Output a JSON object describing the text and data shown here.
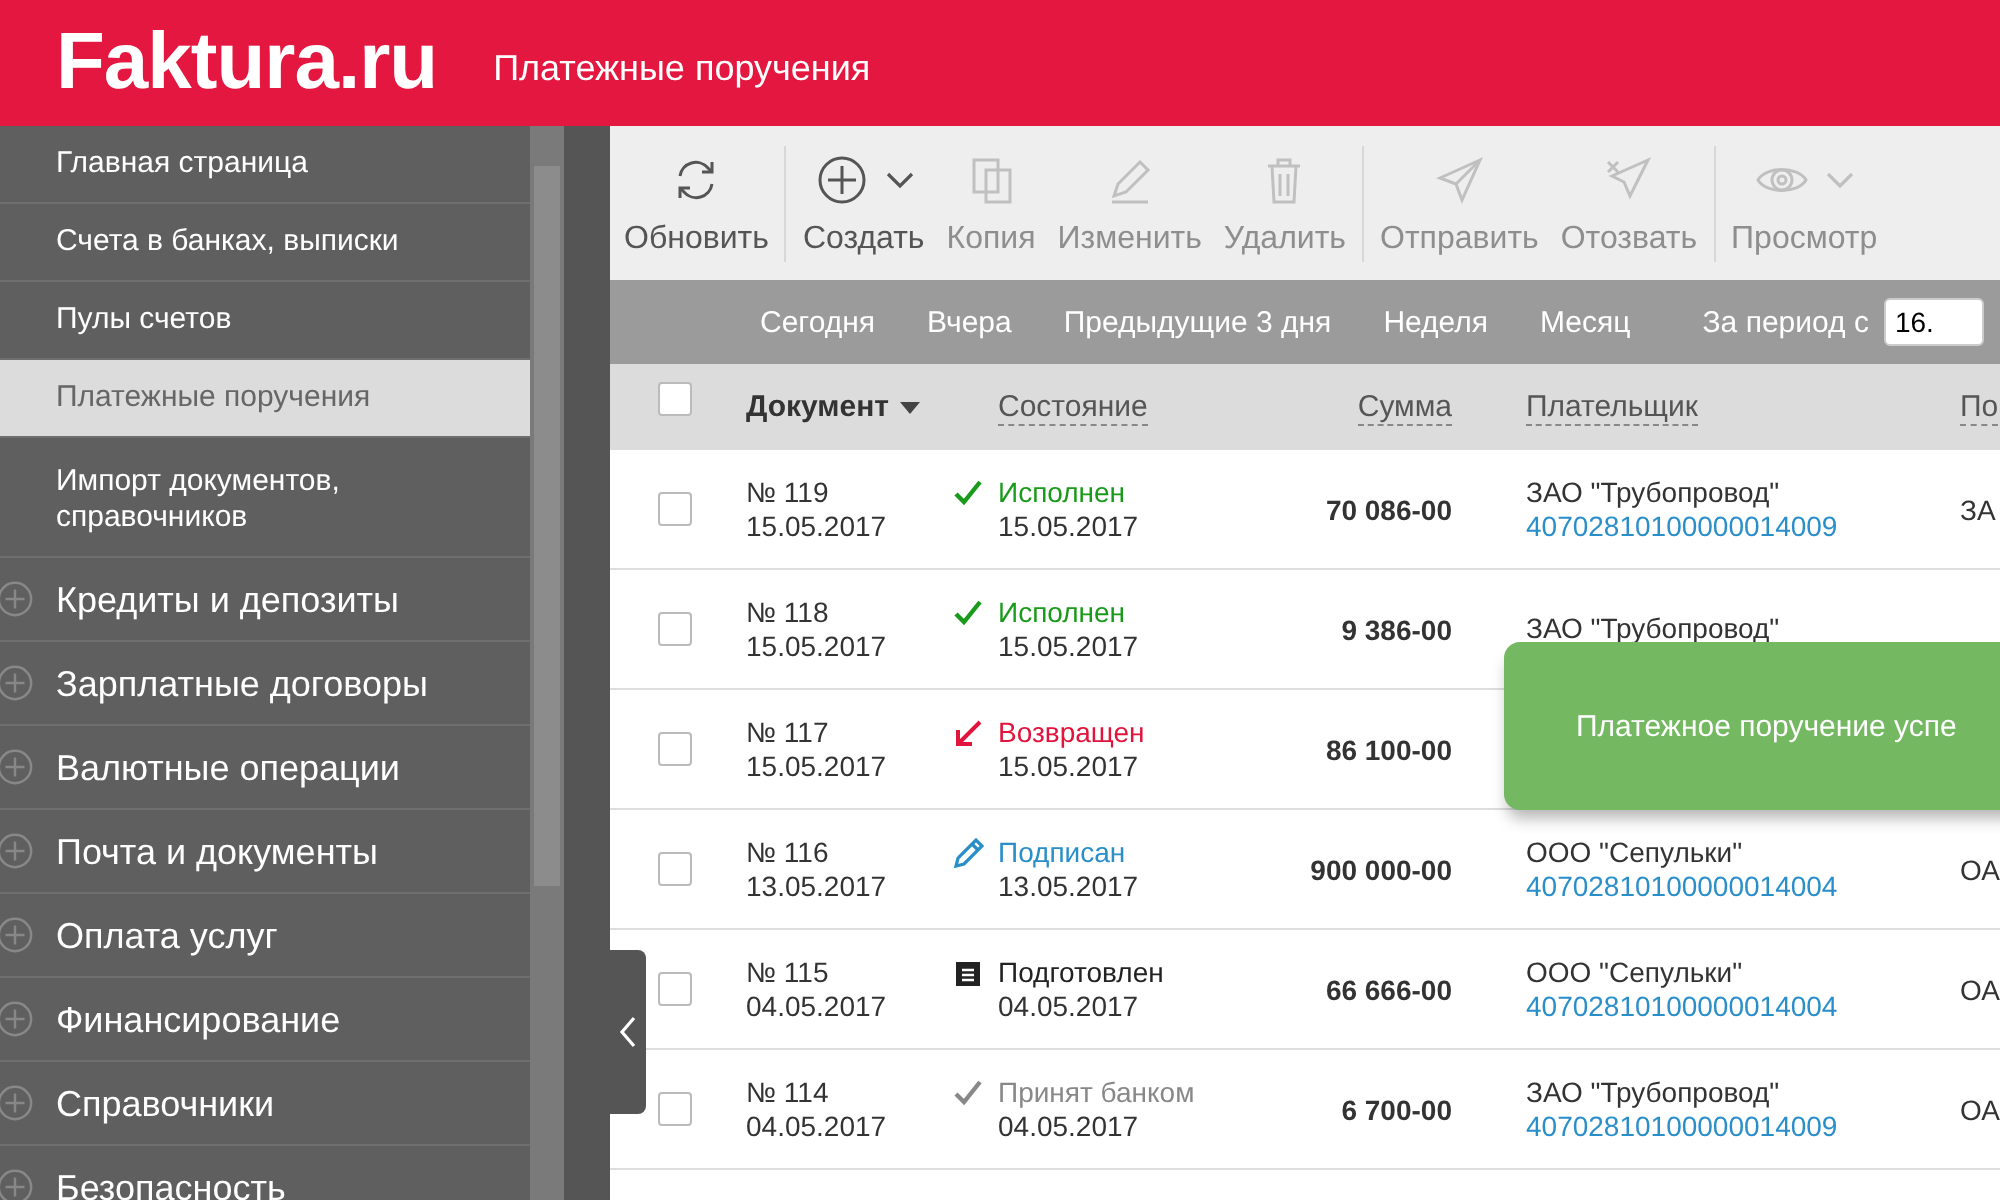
{
  "header": {
    "logo": "Faktura.ru",
    "title": "Платежные поручения"
  },
  "sidebar": {
    "items": [
      {
        "label": "Главная страница",
        "kind": "link",
        "selected": false
      },
      {
        "label": "Счета в банках, выписки",
        "kind": "link",
        "selected": false
      },
      {
        "label": "Пулы счетов",
        "kind": "link",
        "selected": false
      },
      {
        "label": "Платежные поручения",
        "kind": "link",
        "selected": true
      },
      {
        "label": "Импорт документов, справочников",
        "kind": "link",
        "selected": false
      },
      {
        "label": "Кредиты и депозиты",
        "kind": "group",
        "selected": false
      },
      {
        "label": "Зарплатные договоры",
        "kind": "group",
        "selected": false
      },
      {
        "label": "Валютные операции",
        "kind": "group",
        "selected": false
      },
      {
        "label": "Почта и документы",
        "kind": "group",
        "selected": false
      },
      {
        "label": "Оплата услуг",
        "kind": "group",
        "selected": false
      },
      {
        "label": "Финансирование",
        "kind": "group",
        "selected": false
      },
      {
        "label": "Справочники",
        "kind": "group",
        "selected": false
      },
      {
        "label": "Безопасность",
        "kind": "group",
        "selected": false
      }
    ]
  },
  "toolbar": [
    {
      "label": "Обновить",
      "kind": "refresh",
      "disabled": false,
      "dropdown": false,
      "separator_after": true
    },
    {
      "label": "Создать",
      "kind": "create",
      "disabled": false,
      "dropdown": true,
      "separator_after": false
    },
    {
      "label": "Копия",
      "kind": "copy",
      "disabled": true,
      "dropdown": false,
      "separator_after": false
    },
    {
      "label": "Изменить",
      "kind": "edit",
      "disabled": true,
      "dropdown": false,
      "separator_after": false
    },
    {
      "label": "Удалить",
      "kind": "delete",
      "disabled": true,
      "dropdown": false,
      "separator_after": true
    },
    {
      "label": "Отправить",
      "kind": "send",
      "disabled": true,
      "dropdown": false,
      "separator_after": false
    },
    {
      "label": "Отозвать",
      "kind": "recall",
      "disabled": true,
      "dropdown": false,
      "separator_after": true
    },
    {
      "label": "Просмотр",
      "kind": "view",
      "disabled": true,
      "dropdown": true,
      "separator_after": false
    }
  ],
  "filters": {
    "items": [
      "Сегодня",
      "Вчера",
      "Предыдущие 3 дня",
      "Неделя",
      "Месяц"
    ],
    "period_label": "За период с",
    "period_from": "16."
  },
  "table": {
    "select_all_checked": false,
    "columns": [
      "Документ",
      "Состояние",
      "Сумма",
      "Плательщик",
      "По"
    ],
    "rows": [
      {
        "checked": false,
        "number": "№ 119",
        "date": "15.05.2017",
        "status": "Исполнен",
        "kind": "executed",
        "status_date": "15.05.2017",
        "amount": "70 086-00",
        "payer": "ЗАО \"Трубопровод\"",
        "account": "40702810100000014009",
        "column_5": "ЗА"
      },
      {
        "checked": false,
        "number": "№ 118",
        "date": "15.05.2017",
        "status": "Исполнен",
        "kind": "executed",
        "status_date": "15.05.2017",
        "amount": "9 386-00",
        "payer": "ЗАО \"Трубопровод\""
      },
      {
        "checked": false,
        "number": "№ 117",
        "date": "15.05.2017",
        "status": "Возвращен",
        "kind": "returned",
        "status_date": "15.05.2017",
        "amount": "86 100-00"
      },
      {
        "checked": false,
        "number": "№ 116",
        "date": "13.05.2017",
        "status": "Подписан",
        "kind": "signed",
        "status_date": "13.05.2017",
        "amount": "900 000-00",
        "payer": "ООО \"Сепульки\"",
        "account": "40702810100000014004",
        "column_5": "ОА"
      },
      {
        "checked": false,
        "number": "№ 115",
        "date": "04.05.2017",
        "status": "Подготовлен",
        "kind": "prepared",
        "status_date": "04.05.2017",
        "amount": "66 666-00",
        "payer": "ООО \"Сепульки\"",
        "account": "40702810100000014004",
        "column_5": "ОА"
      },
      {
        "checked": false,
        "number": "№ 114",
        "date": "04.05.2017",
        "status": "Принят банком",
        "kind": "accepted",
        "status_date": "04.05.2017",
        "amount": "6 700-00",
        "payer": "ЗАО \"Трубопровод\"",
        "account": "40702810100000014009",
        "column_5": "ОА"
      }
    ]
  },
  "toast": {
    "message": "Платежное поручение успе"
  }
}
